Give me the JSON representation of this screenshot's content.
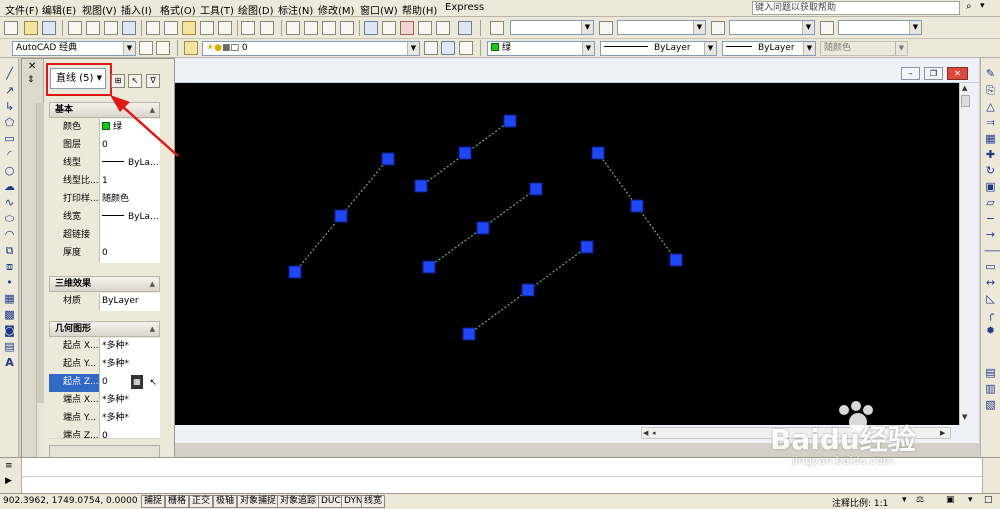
{
  "menubar": {
    "items": [
      "文件(F)",
      "编辑(E)",
      "视图(V)",
      "插入(I)",
      "格式(O)",
      "工具(T)",
      "绘图(D)",
      "标注(N)",
      "修改(M)",
      "窗口(W)",
      "帮助(H)",
      "Express"
    ],
    "help_search_placeholder": "键入问题以获取帮助"
  },
  "toolbar2": {
    "workspace": "AutoCAD 经典",
    "layer_value": "0",
    "color_value": "绿",
    "linetype_value": "ByLayer",
    "lineweight_value": "ByLayer",
    "plotstyle_value": "随颜色"
  },
  "properties": {
    "selection_combo": "直线 (5)",
    "sections": {
      "basic": "基本",
      "three_d": "三维效果",
      "geometry": "几何图形"
    },
    "basic_rows": [
      {
        "key": "颜色",
        "value": "绿"
      },
      {
        "key": "图层",
        "value": "0"
      },
      {
        "key": "线型",
        "value": "ByLa..."
      },
      {
        "key": "线型比...",
        "value": "1"
      },
      {
        "key": "打印样...",
        "value": "随颜色"
      },
      {
        "key": "线宽",
        "value": "ByLa..."
      },
      {
        "key": "超链接",
        "value": ""
      },
      {
        "key": "厚度",
        "value": "0"
      }
    ],
    "three_d_rows": [
      {
        "key": "材质",
        "value": "ByLayer"
      }
    ],
    "geometry_rows": [
      {
        "key": "起点 X...",
        "value": "*多种*"
      },
      {
        "key": "起点 Y...",
        "value": "*多种*"
      },
      {
        "key": "起点 Z...",
        "value": "0"
      },
      {
        "key": "端点 X...",
        "value": "*多种*"
      },
      {
        "key": "端点 Y...",
        "value": "*多种*"
      },
      {
        "key": "端点 Z...",
        "value": "0"
      }
    ],
    "strip_label": "特性"
  },
  "canvas": {
    "background": "#000000",
    "grip_color": "#1f47f5",
    "line_color": "#7fd17f"
  },
  "statusbar": {
    "coords": "902.3962,  1749.0754, 0.0000",
    "buttons": [
      "捕捉",
      "栅格",
      "正交",
      "极轴",
      "对象捕捉",
      "对象追踪",
      "DUCS",
      "DYN",
      "线宽"
    ],
    "annotation_scale": "注释比例: 1:1"
  },
  "watermark": {
    "text": "Baidu经验",
    "url": "jingyan.baidu.com"
  }
}
